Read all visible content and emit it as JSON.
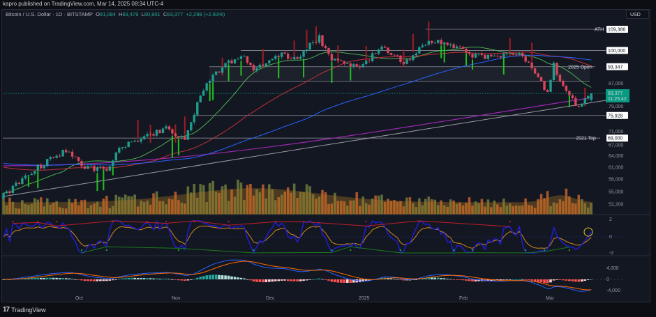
{
  "header": {
    "published": "kapro published on TradingView.com, Mar 14, 2025 08:34 UTC-4"
  },
  "symbol": {
    "name": "Bitcoin / U.S. Dollar · 1D · BITSTAMP",
    "open_label": "O",
    "open": "81,084",
    "high_label": "H",
    "high": "83,479",
    "low_label": "L",
    "low": "80,801",
    "close_label": "C",
    "close": "83,377",
    "change": "+2,298 (+2.83%)"
  },
  "currency_button": "USD",
  "price_axis": [
    "87,000",
    "79,000",
    "71,000",
    "67,000",
    "64,000",
    "61,000",
    "58,000",
    "55,000",
    "52,200"
  ],
  "levels": [
    {
      "label": "ATH",
      "value": "109,386",
      "price": 109386
    },
    {
      "label": "",
      "value": "100,000",
      "price": 100000
    },
    {
      "label": "2025 Open",
      "value": "93,347",
      "price": 93347
    },
    {
      "label": "",
      "value": "75,928",
      "price": 75928
    },
    {
      "label": "2021 Top",
      "value": "69,000",
      "price": 69000
    }
  ],
  "current_price": {
    "value": "83,377",
    "countdown": "11:25:42",
    "price": 83377
  },
  "osc_axis": [
    "2",
    "0",
    "-2"
  ],
  "macd_axis": [
    "4,000",
    "0",
    "-4,000"
  ],
  "date_axis": [
    "Oct",
    "Nov",
    "Dec",
    "2025",
    "Feb",
    "Mar"
  ],
  "footer": {
    "brand": "TradingView",
    "logo": "17"
  },
  "colors": {
    "up": "#1f9c8c",
    "down": "#d9455a",
    "bg": "#131722",
    "accent": "#089981"
  },
  "chart_data": {
    "type": "candlestick",
    "price_waypoints": [
      [
        0,
        54000
      ],
      [
        11,
        61000
      ],
      [
        20,
        65500
      ],
      [
        26,
        61000
      ],
      [
        33,
        60500
      ],
      [
        38,
        67000
      ],
      [
        44,
        68500
      ],
      [
        52,
        72300
      ],
      [
        58,
        68000
      ],
      [
        65,
        88000
      ],
      [
        67,
        90000
      ],
      [
        76,
        98500
      ],
      [
        80,
        92000
      ],
      [
        89,
        98000
      ],
      [
        94,
        96500
      ],
      [
        101,
        106000
      ],
      [
        104,
        97500
      ],
      [
        114,
        92500
      ],
      [
        121,
        102000
      ],
      [
        128,
        94500
      ],
      [
        135,
        103000
      ],
      [
        137,
        104000
      ],
      [
        147,
        100500
      ],
      [
        149,
        97500
      ],
      [
        166,
        98000
      ],
      [
        171,
        88500
      ],
      [
        174,
        84000
      ],
      [
        176,
        94000
      ],
      [
        178,
        87000
      ],
      [
        184,
        78500
      ],
      [
        188,
        83377
      ]
    ],
    "price_waypoint_units": "day index from Sep 7 2024, USD"
  }
}
